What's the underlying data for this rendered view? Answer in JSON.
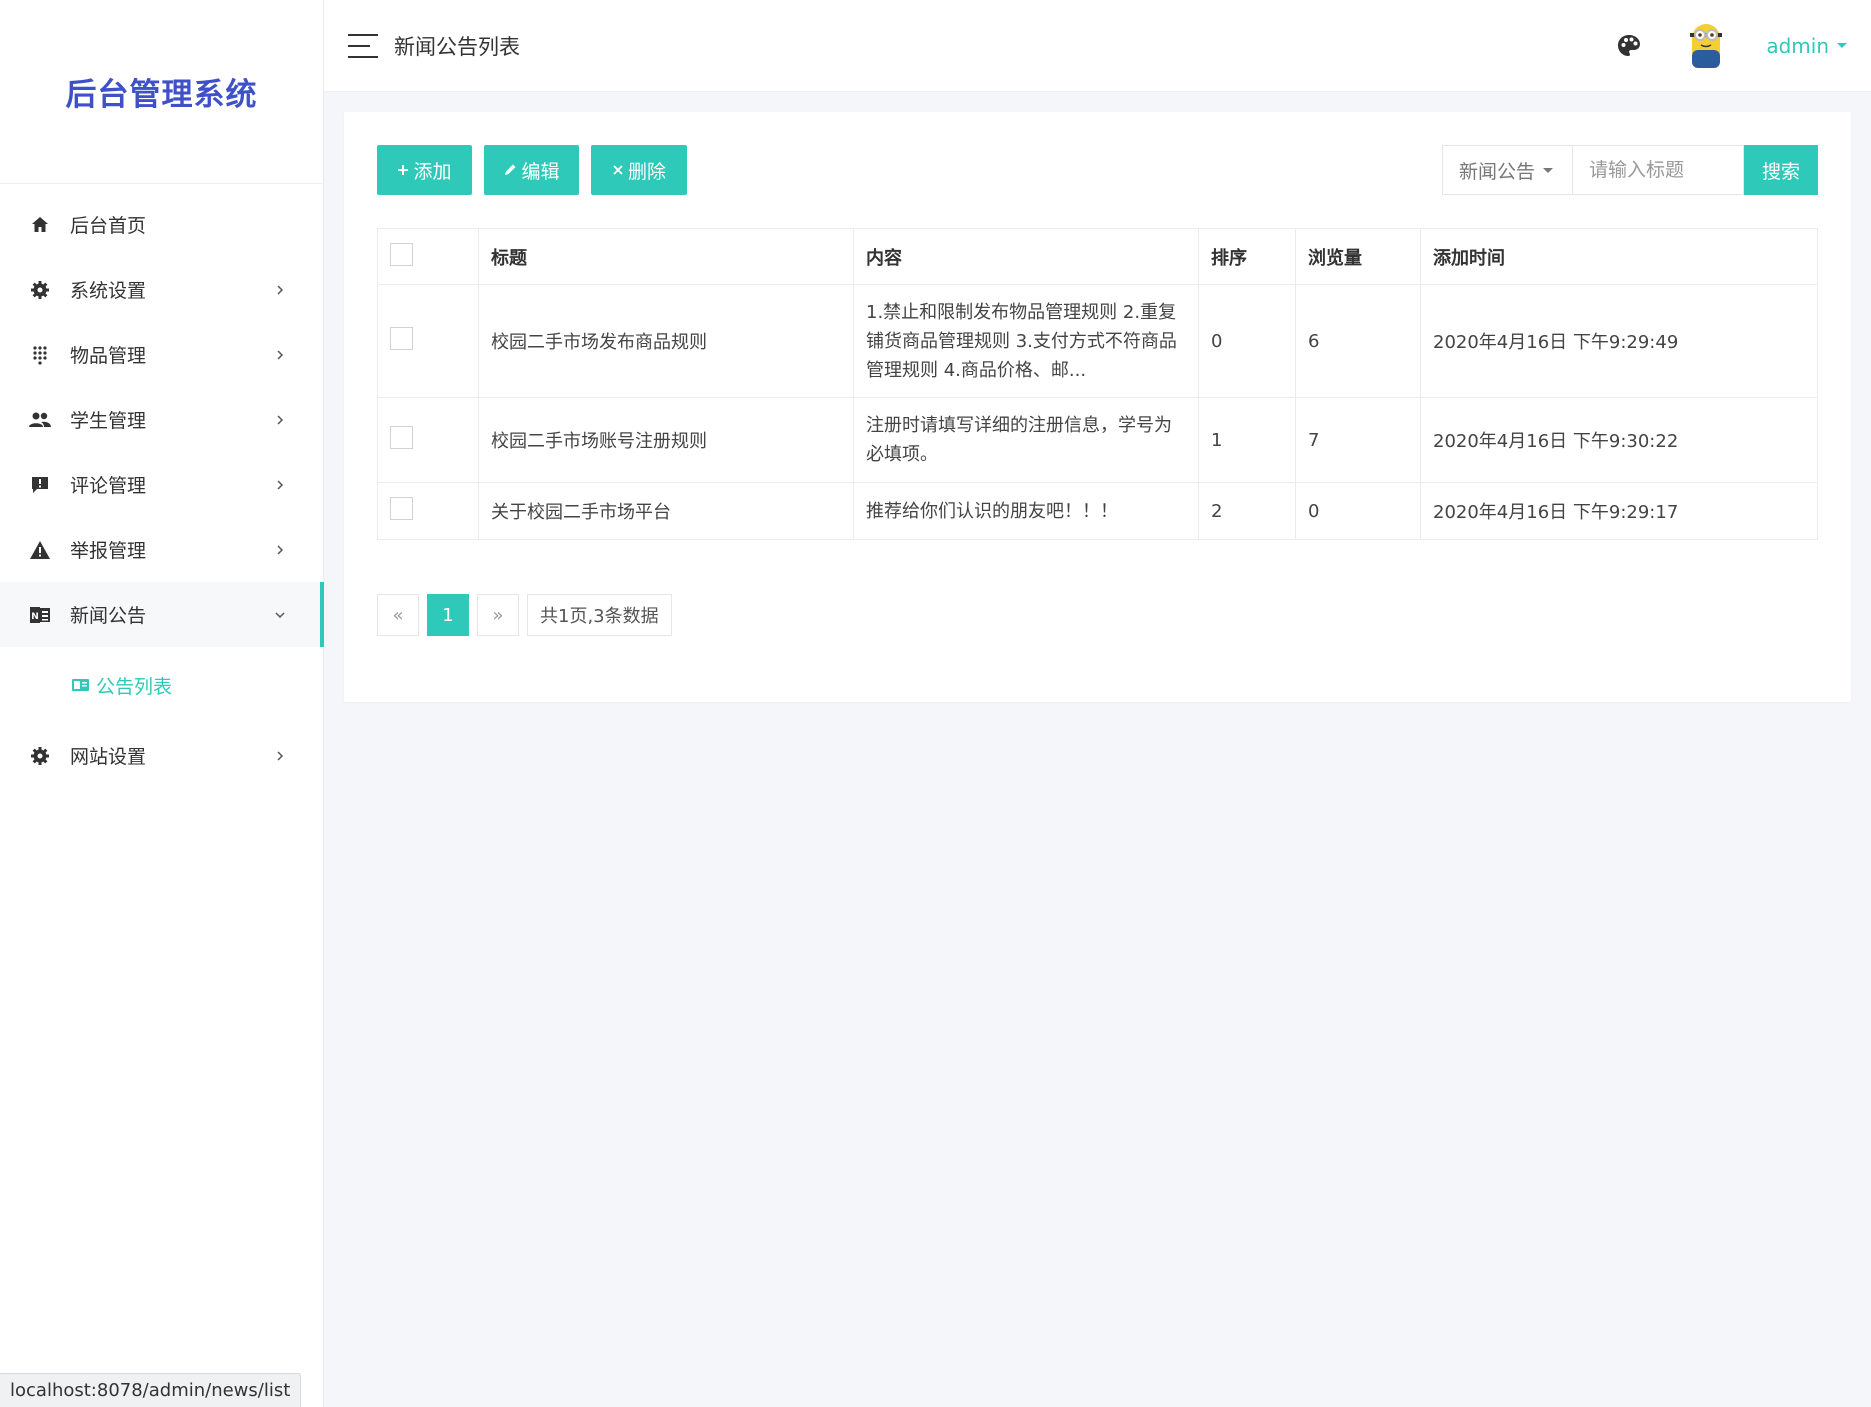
{
  "brand": {
    "title": "后台管理系统",
    "color": "#3f51c9"
  },
  "accent_color": "#2ec9b8",
  "time_color": "#2eae5e",
  "sidebar": {
    "items": [
      {
        "label": "后台首页",
        "icon": "home-icon",
        "has_arrow": false
      },
      {
        "label": "系统设置",
        "icon": "gear-icon",
        "has_arrow": true
      },
      {
        "label": "物品管理",
        "icon": "grid-dots-icon",
        "has_arrow": true
      },
      {
        "label": "学生管理",
        "icon": "users-icon",
        "has_arrow": true
      },
      {
        "label": "评论管理",
        "icon": "comment-icon",
        "has_arrow": true
      },
      {
        "label": "举报管理",
        "icon": "warning-icon",
        "has_arrow": true
      },
      {
        "label": "新闻公告",
        "icon": "news-icon",
        "has_arrow": true,
        "expanded": true,
        "active": true
      },
      {
        "label": "网站设置",
        "icon": "gear-icon",
        "has_arrow": true
      }
    ],
    "submenu": {
      "label": "公告列表",
      "icon": "list-card-icon"
    }
  },
  "header": {
    "page_title": "新闻公告列表",
    "user": "admin"
  },
  "toolbar": {
    "add_label": "添加",
    "edit_label": "编辑",
    "delete_label": "删除"
  },
  "search": {
    "category": "新闻公告",
    "placeholder": "请输入标题",
    "value": "",
    "button_label": "搜索"
  },
  "table": {
    "columns": [
      "标题",
      "内容",
      "排序",
      "浏览量",
      "添加时间"
    ],
    "rows": [
      {
        "title": "校园二手市场发布商品规则",
        "content": "1.禁止和限制发布物品管理规则 2.重复铺货商品管理规则 3.支付方式不符商品管理规则 4.商品价格、邮...",
        "sort": "0",
        "views": "6",
        "time": "2020年4月16日 下午9:29:49"
      },
      {
        "title": "校园二手市场账号注册规则",
        "content": "注册时请填写详细的注册信息，学号为必填项。",
        "sort": "1",
        "views": "7",
        "time": "2020年4月16日 下午9:30:22"
      },
      {
        "title": "关于校园二手市场平台",
        "content": "推荐给你们认识的朋友吧！！！",
        "sort": "2",
        "views": "0",
        "time": "2020年4月16日 下午9:29:17"
      }
    ]
  },
  "pagination": {
    "prev": "«",
    "current": "1",
    "next": "»",
    "info": "共1页,3条数据"
  },
  "status_url": "localhost:8078/admin/news/list"
}
